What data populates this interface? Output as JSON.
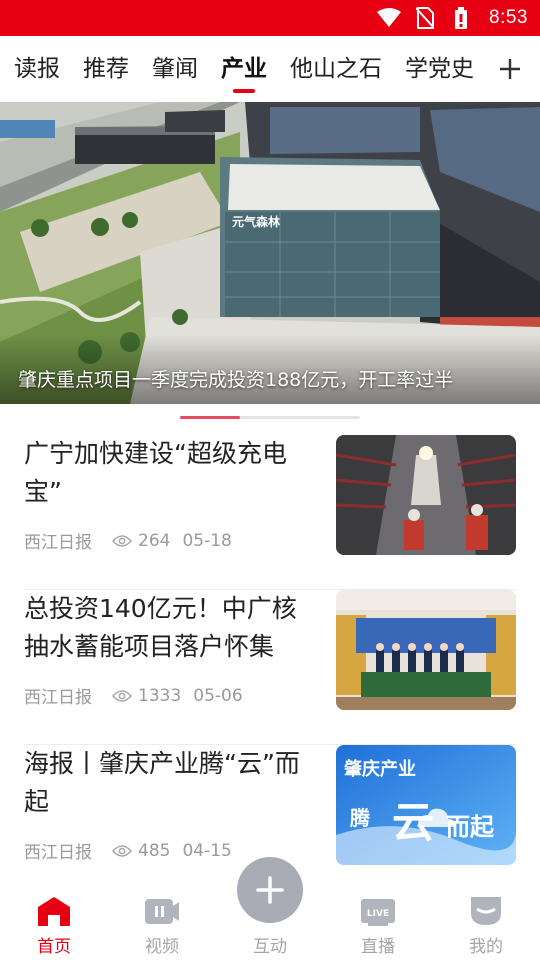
{
  "status_bar": {
    "time": "8:53",
    "icons": [
      "wifi-icon",
      "no-sim-icon",
      "battery-icon"
    ],
    "background": "#e60012"
  },
  "tabs": [
    {
      "label": "读报"
    },
    {
      "label": "推荐"
    },
    {
      "label": "肇闻"
    },
    {
      "label": "产业",
      "active": true
    },
    {
      "label": "他山之石"
    },
    {
      "label": "学党史"
    }
  ],
  "banner": {
    "caption": "肇庆重点项目一季度完成投资188亿元，开工率过半",
    "building_sign": "元气森林",
    "carousel_index": 1,
    "carousel_count": 3
  },
  "news": [
    {
      "title": "广宁加快建设“超级充电宝”",
      "source": "西江日报",
      "views": "264",
      "date": "05-18",
      "thumb_icon": "tunnel-construction-image"
    },
    {
      "title": "总投资140亿元！中广核抽水蓄能项目落户怀集",
      "source": "西江日报",
      "views": "1333",
      "date": "05-06",
      "thumb_icon": "signing-ceremony-image"
    },
    {
      "title": "海报丨肇庆产业腾“云”而起",
      "source": "西江日报",
      "views": "485",
      "date": "04-15",
      "thumb_icon": "poster-image",
      "thumb_text": {
        "line1": "肇庆产业",
        "line2": "腾",
        "line3": "云",
        "line4": "而起"
      }
    }
  ],
  "bottom_nav": [
    {
      "label": "首页",
      "icon": "home-icon",
      "active": true
    },
    {
      "label": "视频",
      "icon": "video-icon"
    },
    {
      "label": "互动",
      "icon": "plus-icon"
    },
    {
      "label": "直播",
      "icon": "live-icon",
      "badge": "LIVE"
    },
    {
      "label": "我的",
      "icon": "profile-icon"
    }
  ],
  "colors": {
    "accent": "#e60012",
    "inactive": "#a6a6a6",
    "fab": "#a9acb4"
  }
}
